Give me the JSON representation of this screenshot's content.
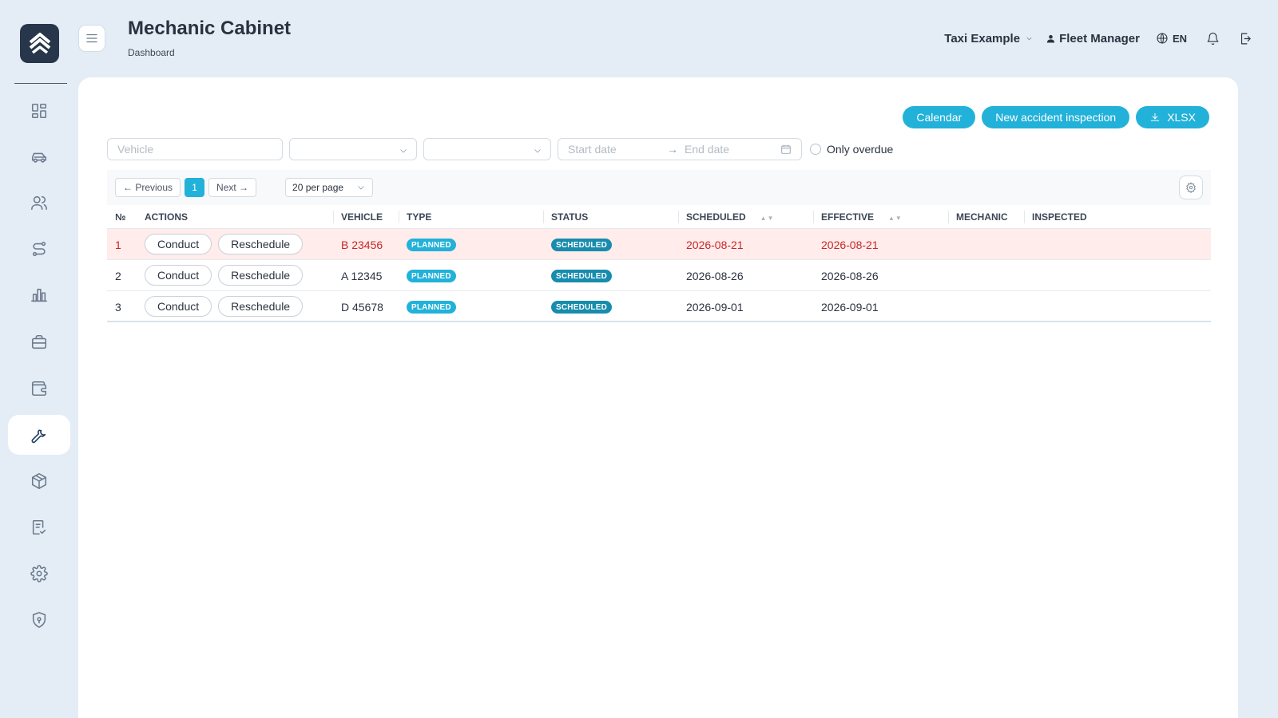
{
  "app": {
    "title": "Mechanic Cabinet",
    "breadcrumb": "Dashboard"
  },
  "header": {
    "company": "Taxi Example",
    "user": "Fleet Manager",
    "language": "EN"
  },
  "sidebar": {
    "items": [
      {
        "id": "dashboard",
        "icon": "dashboard-icon",
        "active": false
      },
      {
        "id": "vehicles",
        "icon": "car-icon",
        "active": false
      },
      {
        "id": "drivers",
        "icon": "users-icon",
        "active": false
      },
      {
        "id": "routes",
        "icon": "route-icon",
        "active": false
      },
      {
        "id": "reports",
        "icon": "bar-chart-icon",
        "active": false
      },
      {
        "id": "business",
        "icon": "briefcase-icon",
        "active": false
      },
      {
        "id": "wallet",
        "icon": "wallet-icon",
        "active": false
      },
      {
        "id": "mechanic",
        "icon": "wrench-icon",
        "active": true
      },
      {
        "id": "inventory",
        "icon": "box-icon",
        "active": false
      },
      {
        "id": "checklist",
        "icon": "clipboard-check-icon",
        "active": false
      },
      {
        "id": "settings",
        "icon": "gear-icon",
        "active": false
      },
      {
        "id": "security",
        "icon": "shield-icon",
        "active": false
      }
    ]
  },
  "actions": {
    "calendar": "Calendar",
    "new_inspection": "New accident inspection",
    "export": "XLSX"
  },
  "filters": {
    "vehicle_placeholder": "Vehicle",
    "start_date_placeholder": "Start date",
    "end_date_placeholder": "End date",
    "date_arrow": "→",
    "only_overdue": "Only overdue"
  },
  "pagination": {
    "previous": "← Previous",
    "current": "1",
    "next": "Next →",
    "per_page": "20 per page"
  },
  "table": {
    "columns": {
      "no": "№",
      "actions": "Actions",
      "vehicle": "Vehicle",
      "type": "Type",
      "status": "Status",
      "scheduled": "Scheduled",
      "effective": "Effective",
      "mechanic": "Mechanic",
      "inspected": "Inspected"
    },
    "conduct_label": "Conduct",
    "reschedule_label": "Reschedule",
    "rows": [
      {
        "no": "1",
        "vehicle": "B 23456",
        "type": "PLANNED",
        "status": "SCHEDULED",
        "scheduled": "2026-08-21",
        "effective": "2026-08-21",
        "mechanic": "",
        "inspected": "",
        "overdue": true
      },
      {
        "no": "2",
        "vehicle": "A 12345",
        "type": "PLANNED",
        "status": "SCHEDULED",
        "scheduled": "2026-08-26",
        "effective": "2026-08-26",
        "mechanic": "",
        "inspected": "",
        "overdue": false
      },
      {
        "no": "3",
        "vehicle": "D 45678",
        "type": "PLANNED",
        "status": "SCHEDULED",
        "scheduled": "2026-09-01",
        "effective": "2026-09-01",
        "mechanic": "",
        "inspected": "",
        "overdue": false
      }
    ]
  },
  "colors": {
    "accent": "#22b1d9",
    "status_scheduled": "#178cad",
    "overdue_text": "#c62828",
    "overdue_bg": "#ffeceb",
    "page_bg": "#e4edf6",
    "logo_bg": "#27364a"
  }
}
